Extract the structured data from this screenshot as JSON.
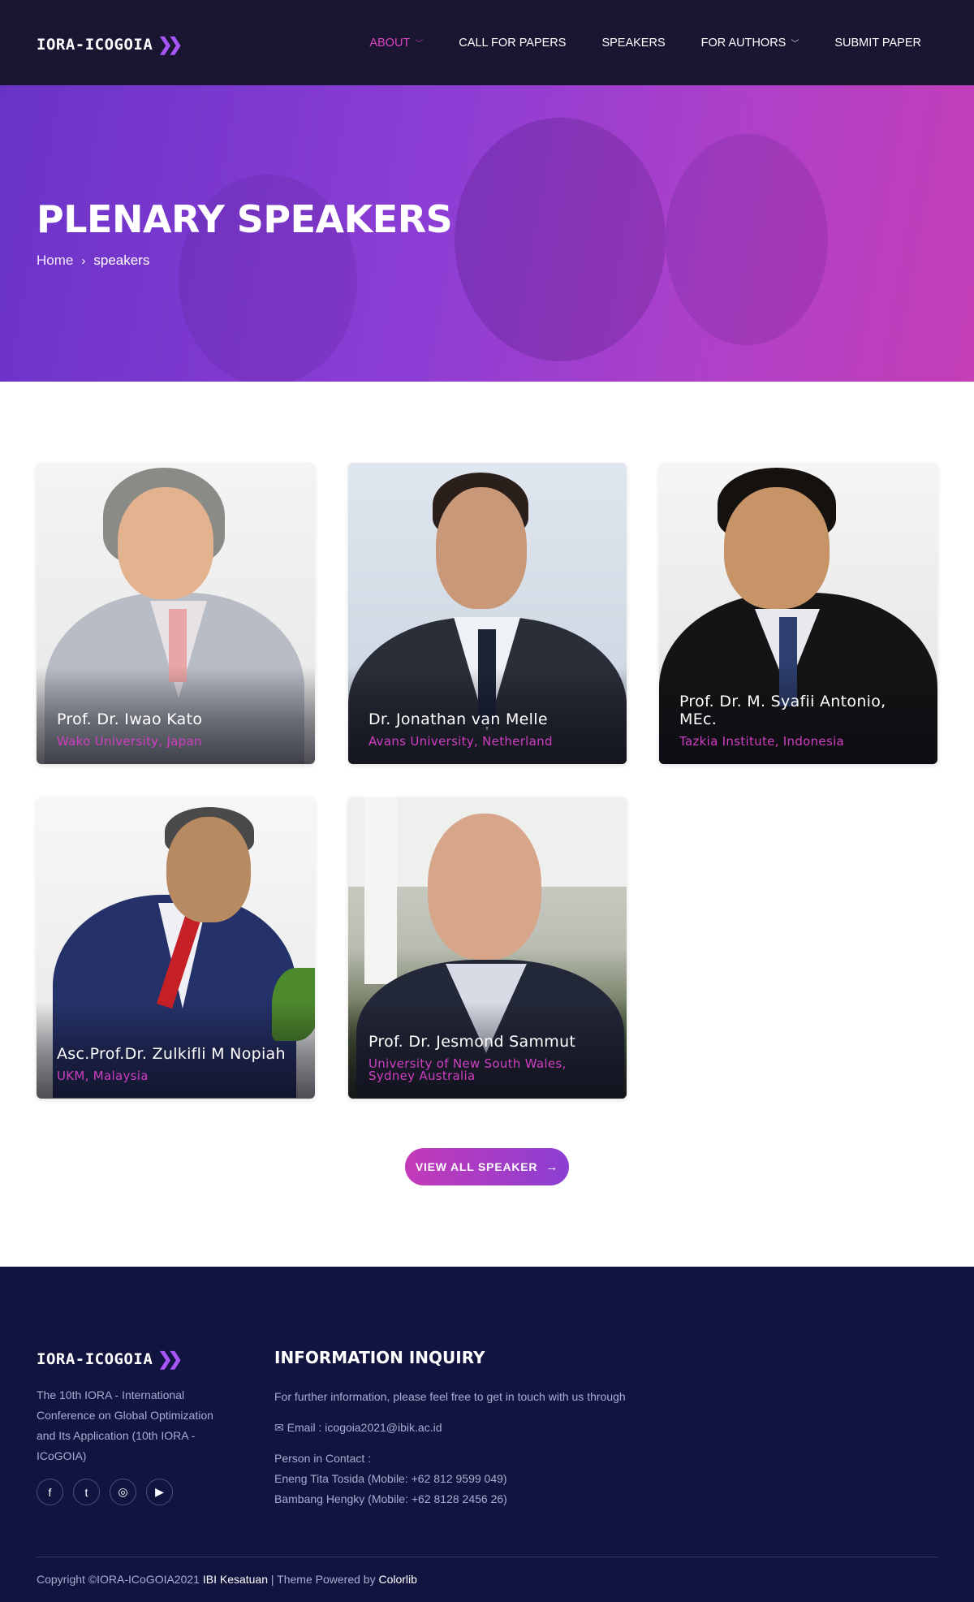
{
  "navbar": {
    "logo_text": "IORA-ICOGOIA",
    "logo_mark": "»",
    "items": [
      {
        "label": "ABOUT",
        "has_caret": true,
        "active": true
      },
      {
        "label": "CALL FOR PAPERS",
        "has_caret": false,
        "active": false
      },
      {
        "label": "SPEAKERS",
        "has_caret": false,
        "active": false
      },
      {
        "label": "FOR AUTHORS",
        "has_caret": true,
        "active": false
      },
      {
        "label": "SUBMIT PAPER",
        "has_caret": false,
        "active": false
      }
    ]
  },
  "hero": {
    "title": "PLENARY SPEAKERS",
    "breadcrumb": {
      "home": "Home",
      "separator": "›",
      "current": "speakers"
    }
  },
  "speakers": [
    {
      "name": "Prof. Dr. Iwao Kato",
      "affiliation": "Wako University, Japan"
    },
    {
      "name": "Dr. Jonathan van Melle",
      "affiliation": "Avans University, Netherland"
    },
    {
      "name": "Prof. Dr. M. Syafii Antonio, MEc.",
      "affiliation": "Tazkia Institute, Indonesia"
    },
    {
      "name": "Asc.Prof.Dr. Zulkifli M Nopiah",
      "affiliation": "UKM, Malaysia"
    },
    {
      "name": "Prof. Dr. Jesmond Sammut",
      "affiliation": "University of New South Wales, Sydney Australia"
    }
  ],
  "view_all_button": {
    "label": "VIEW ALL SPEAKER",
    "icon": "arrow-right-icon"
  },
  "footer": {
    "logo_text": "IORA-ICOGOIA",
    "about_text": "The 10th IORA - International Conference on Global Optimization and Its Application (10th IORA - ICoGOIA)",
    "socials": [
      "facebook-icon",
      "twitter-icon",
      "instagram-icon",
      "youtube-icon"
    ],
    "inquiry_heading": "INFORMATION INQUIRY",
    "inquiry_intro": "For further information, please feel free to get in touch with us through",
    "email_line": "Email : icogoia2021@ibik.ac.id",
    "contact_label": "Person in Contact :",
    "contacts": [
      "Eneng Tita Tosida (Mobile: +62 812 9599 049)",
      "Bambang Hengky (Mobile: +62 8128 2456 26)"
    ],
    "copyright_prefix": "Copyright ©IORA-ICoGOIA2021",
    "copyright_link1": "IBI Kesatuan",
    "copyright_mid": "| Theme Powered by",
    "copyright_link2": "Colorlib"
  },
  "colors": {
    "navbar_bg": "#1a1530",
    "accent_pink": "#d03ec2",
    "hero_gradient_start": "#6a33c8",
    "hero_gradient_end": "#c43eb6",
    "footer_bg": "#121440"
  }
}
